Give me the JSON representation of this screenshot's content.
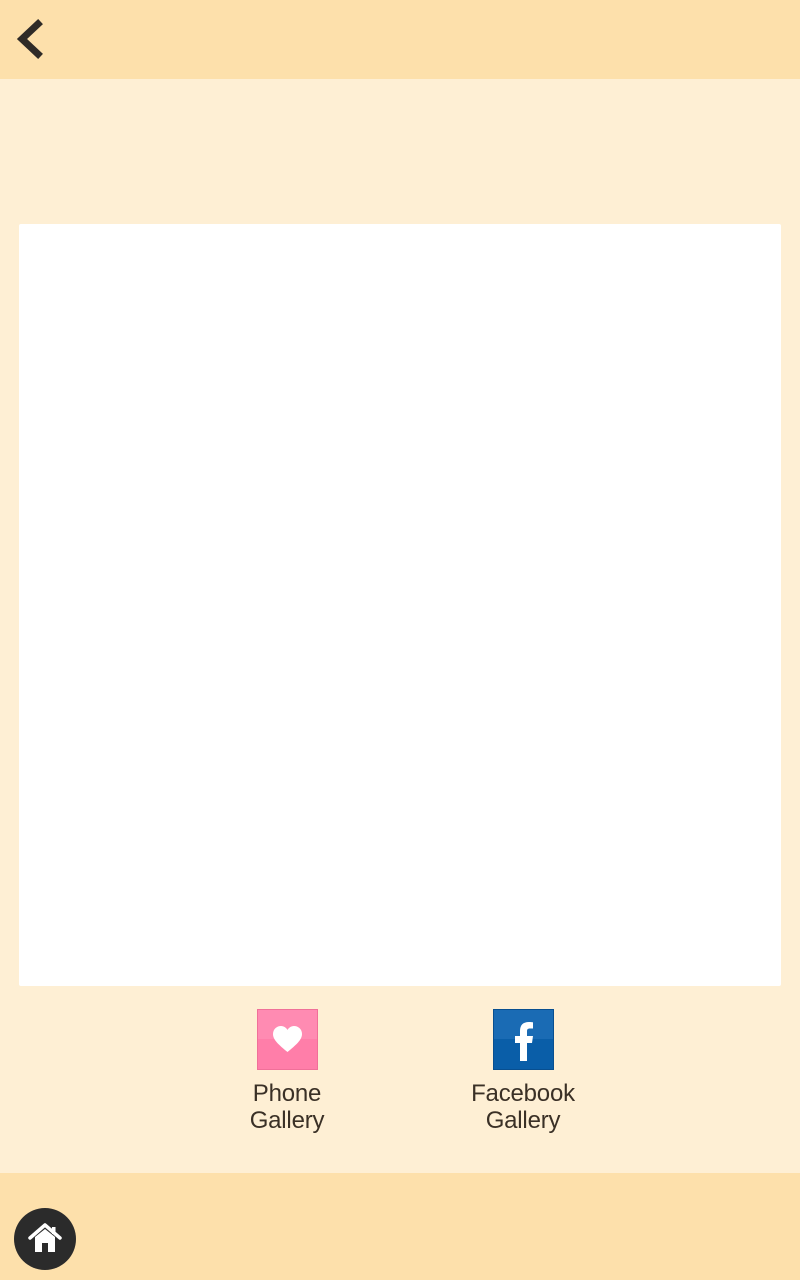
{
  "header": {
    "back_icon": "chevron-left-icon"
  },
  "gallery_options": [
    {
      "line1": "Phone",
      "line2": "Gallery",
      "icon": "heart-icon",
      "icon_color": "#ff7ea9"
    },
    {
      "line1": "Facebook",
      "line2": "Gallery",
      "icon": "facebook-icon",
      "icon_color": "#0a5ea8"
    }
  ],
  "footer": {
    "home_icon": "home-icon"
  },
  "colors": {
    "bar_background": "#fde0ab",
    "page_background": "#feefd4",
    "canvas_background": "#ffffff",
    "text": "#3a3026"
  }
}
